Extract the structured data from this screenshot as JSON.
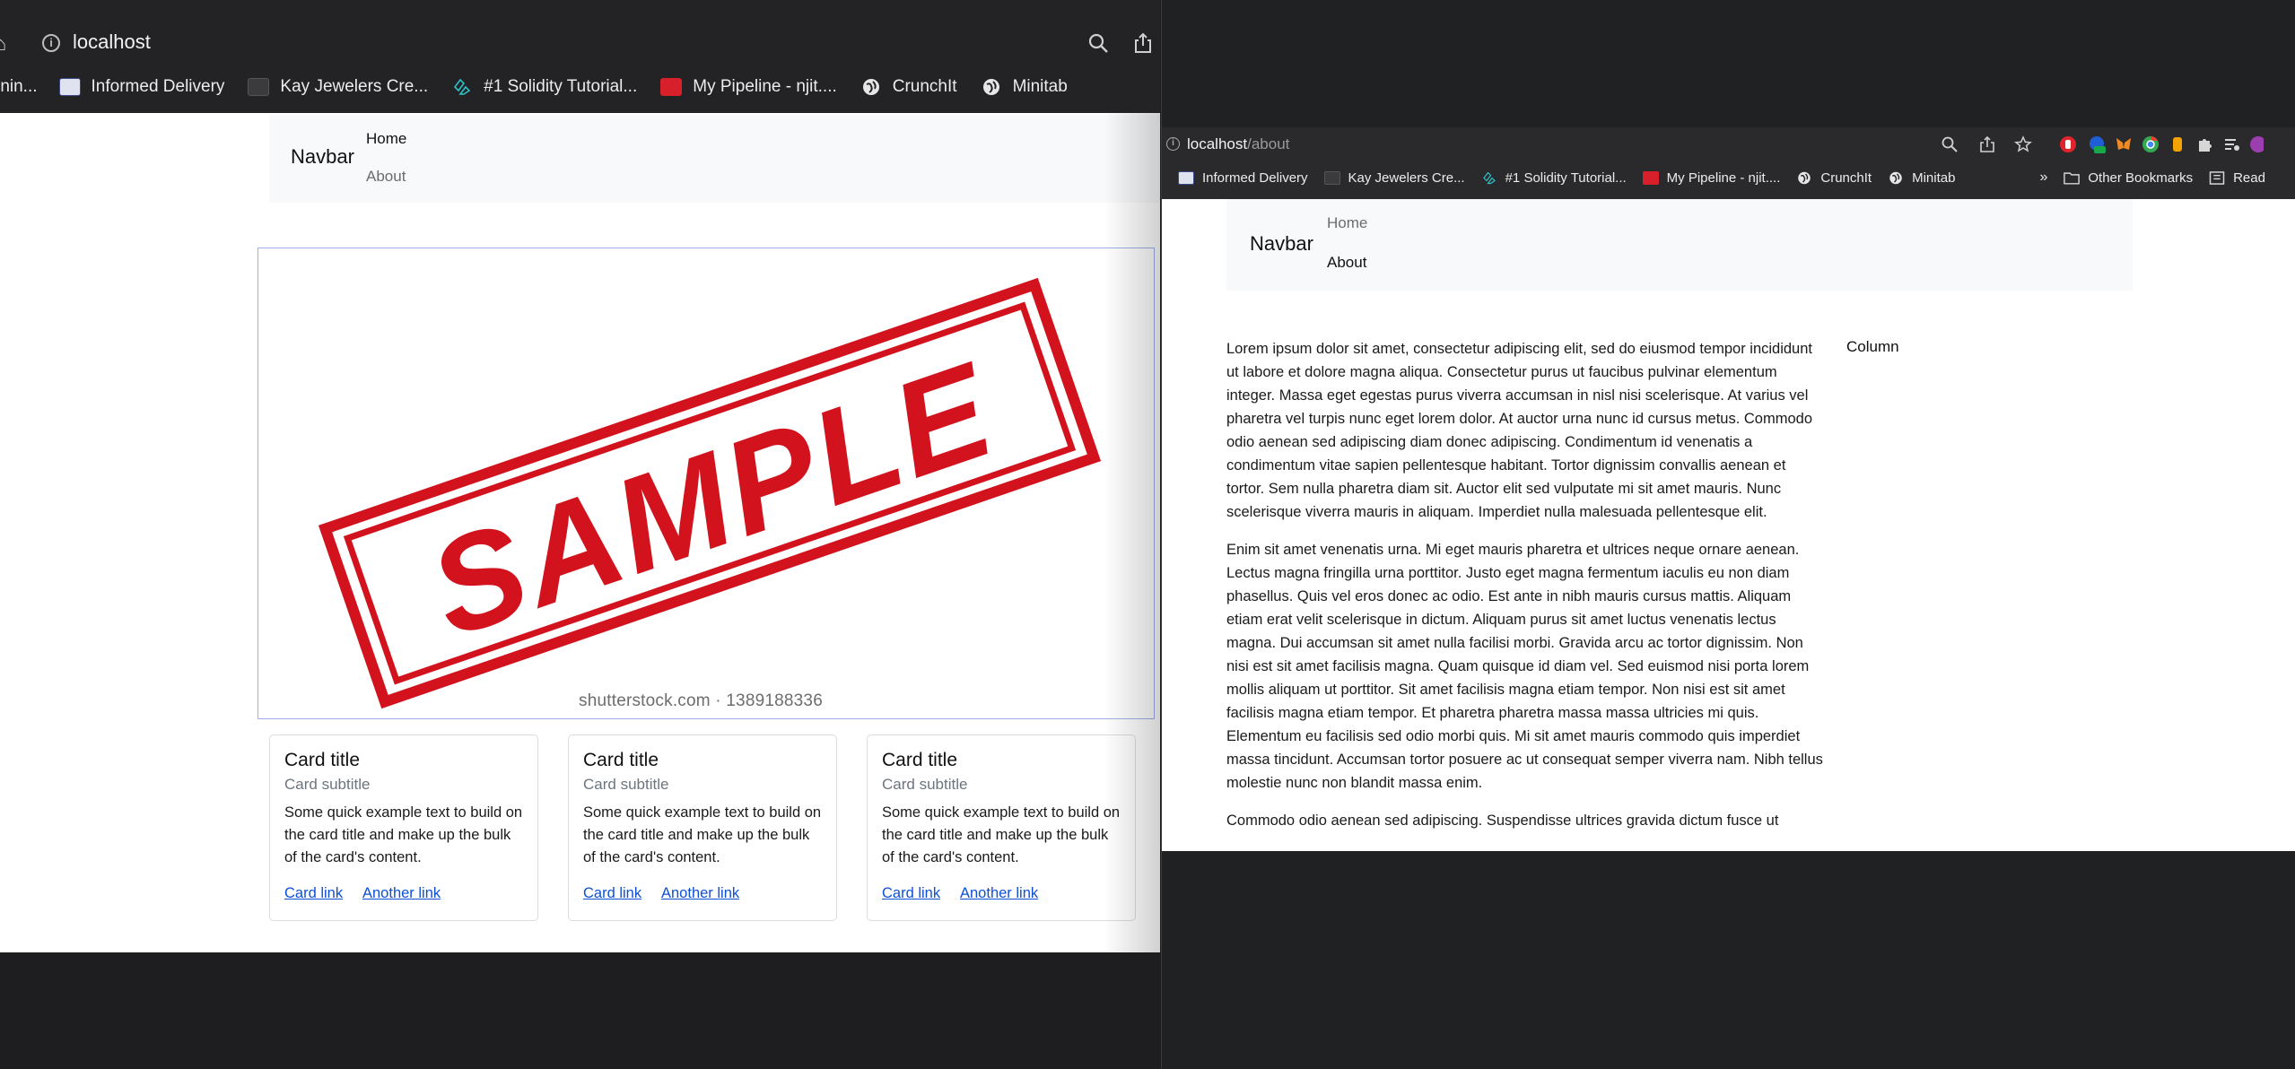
{
  "left_window": {
    "url": "localhost",
    "bookmarks": [
      {
        "label": "rnin...",
        "icon": "bookmark-icon"
      },
      {
        "label": "Informed Delivery",
        "icon": "usps-icon"
      },
      {
        "label": "Kay Jewelers Cre...",
        "icon": "card-icon"
      },
      {
        "label": "#1 Solidity Tutorial...",
        "icon": "solidity-icon"
      },
      {
        "label": "My Pipeline - njit....",
        "icon": "pipeline-icon"
      },
      {
        "label": "CrunchIt",
        "icon": "globe-icon"
      },
      {
        "label": "Minitab",
        "icon": "globe-icon"
      }
    ],
    "navbar": {
      "brand": "Navbar",
      "links": [
        "Home",
        "About"
      ]
    },
    "hero": {
      "stamp_text": "SAMPLE",
      "credit": "shutterstock.com · 1389188336"
    },
    "cards": [
      {
        "title": "Card title",
        "subtitle": "Card subtitle",
        "text": "Some quick example text to build on the card title and make up the bulk of the card's content.",
        "link1": "Card link",
        "link2": "Another link"
      },
      {
        "title": "Card title",
        "subtitle": "Card subtitle",
        "text": "Some quick example text to build on the card title and make up the bulk of the card's content.",
        "link1": "Card link",
        "link2": "Another link"
      },
      {
        "title": "Card title",
        "subtitle": "Card subtitle",
        "text": "Some quick example text to build on the card title and make up the bulk of the card's content.",
        "link1": "Card link",
        "link2": "Another link"
      }
    ]
  },
  "right_window": {
    "url_host": "localhost",
    "url_path": "/about",
    "bookmarks": [
      {
        "label": "Informed Delivery",
        "icon": "usps-icon"
      },
      {
        "label": "Kay Jewelers Cre...",
        "icon": "card-icon"
      },
      {
        "label": "#1 Solidity Tutorial...",
        "icon": "solidity-icon"
      },
      {
        "label": "My Pipeline - njit....",
        "icon": "pipeline-icon"
      },
      {
        "label": "CrunchIt",
        "icon": "globe-icon"
      },
      {
        "label": "Minitab",
        "icon": "globe-icon"
      }
    ],
    "overflow": "»",
    "other_bookmarks": "Other Bookmarks",
    "reading_list": "Read",
    "navbar": {
      "brand": "Navbar",
      "links": [
        "Home",
        "About"
      ]
    },
    "paragraphs": [
      "Lorem ipsum dolor sit amet, consectetur adipiscing elit, sed do eiusmod tempor incididunt ut labore et dolore magna aliqua. Consectetur purus ut faucibus pulvinar elementum integer. Massa eget egestas purus viverra accumsan in nisl nisi scelerisque. At varius vel pharetra vel turpis nunc eget lorem dolor. At auctor urna nunc id cursus metus. Commodo odio aenean sed adipiscing diam donec adipiscing. Condimentum id venenatis a condimentum vitae sapien pellentesque habitant. Tortor dignissim convallis aenean et tortor. Sem nulla pharetra diam sit. Auctor elit sed vulputate mi sit amet mauris. Nunc scelerisque viverra mauris in aliquam. Imperdiet nulla malesuada pellentesque elit.",
      "Enim sit amet venenatis urna. Mi eget mauris pharetra et ultrices neque ornare aenean. Lectus magna fringilla urna porttitor. Justo eget magna fermentum iaculis eu non diam phasellus. Quis vel eros donec ac odio. Est ante in nibh mauris cursus mattis. Aliquam etiam erat velit scelerisque in dictum. Aliquam purus sit amet luctus venenatis lectus magna. Dui accumsan sit amet nulla facilisi morbi. Gravida arcu ac tortor dignissim. Non nisi est sit amet facilisis magna. Quam quisque id diam vel. Sed euismod nisi porta lorem mollis aliquam ut porttitor. Sit amet facilisis magna etiam tempor. Non nisi est sit amet facilisis magna etiam tempor. Et pharetra pharetra massa massa ultricies mi quis. Elementum eu facilisis sed odio morbi quis. Mi sit amet mauris commodo quis imperdiet massa tincidunt. Accumsan tortor posuere ac ut consequat semper viverra nam. Nibh tellus molestie nunc non blandit massa enim.",
      "Commodo odio aenean sed adipiscing. Suspendisse ultrices gravida dictum fusce ut"
    ],
    "column_label": "Column"
  },
  "colors": {
    "link": "#0d4fd6",
    "navbar_bg": "#f8f9fa",
    "stamp_red": "#d2131d",
    "chrome_dark": "#232325"
  }
}
